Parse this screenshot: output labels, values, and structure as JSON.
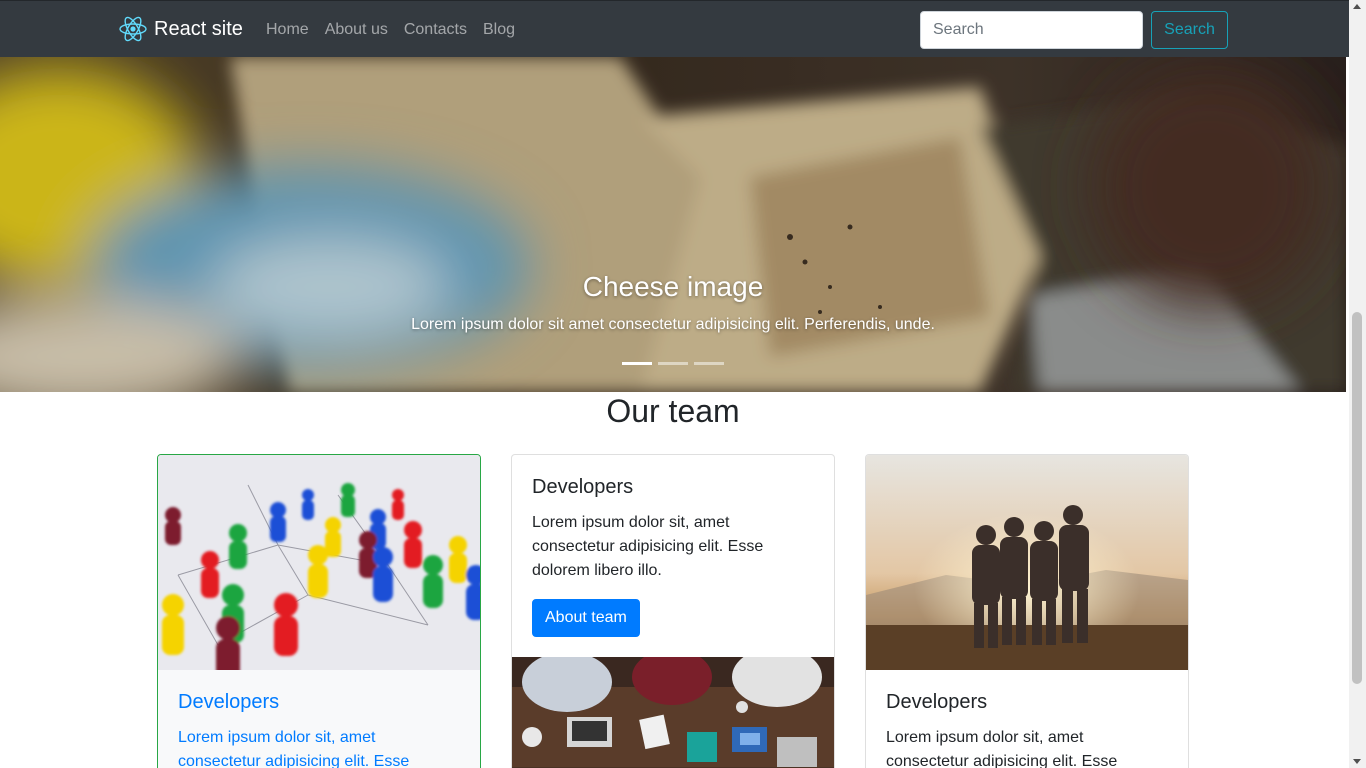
{
  "navbar": {
    "brand": "React site",
    "brand_icon": "react-logo-icon",
    "links": [
      "Home",
      "About us",
      "Contacts",
      "Blog"
    ],
    "search_placeholder": "Search",
    "search_button": "Search",
    "colors": {
      "background": "#343a40",
      "search_accent": "#17a2b8",
      "react_logo": "#61dafb"
    }
  },
  "carousel": {
    "title": "Cheese image",
    "text": "Lorem ipsum dolor sit amet consectetur adipisicing elit. Perferendis, unde.",
    "active_slide": 1,
    "slide_count": 3
  },
  "team": {
    "title": "Our team",
    "cards": [
      {
        "title": "Developers",
        "text": "Lorem ipsum dolor sit, amet consectetur adipisicing elit. Esse",
        "image": "game-pawns-image",
        "accent": "#007bff"
      },
      {
        "title": "Developers",
        "text": "Lorem ipsum dolor sit, amet consectetur adipisicing elit. Esse dolorem libero illo.",
        "button": "About team",
        "image": "team-meeting-image"
      },
      {
        "title": "Developers",
        "text": "Lorem ipsum dolor sit, amet consectetur adipisicing elit. Esse",
        "image": "friends-sunset-image"
      }
    ]
  }
}
